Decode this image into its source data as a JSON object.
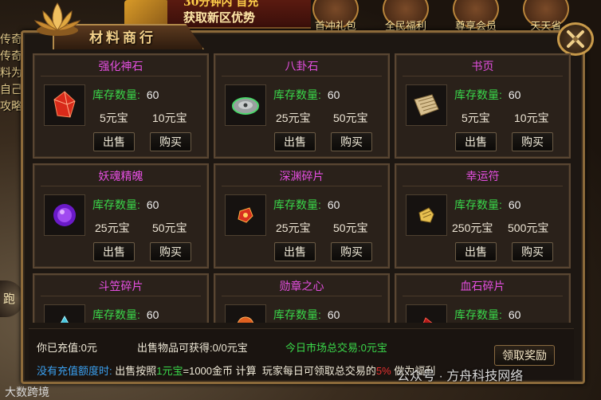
{
  "header": {
    "title": "材料商行",
    "promo_line1": "30分钟内 首充",
    "promo_line2": "获取新区优势",
    "top_icons": [
      "首冲礼包",
      "全民福利",
      "尊享会员",
      "天天省"
    ]
  },
  "side_text": [
    "传奇",
    "传奇",
    "料为",
    "自己",
    "攻略"
  ],
  "side_round_label": "跑",
  "unit": "元宝",
  "stock_label": "库存数量:",
  "sell_label": "出售",
  "buy_label": "购买",
  "items": [
    {
      "name": "强化神石",
      "stock": "60",
      "sell_price": "5元宝",
      "buy_price": "10元宝",
      "icon": "red-crystal-icon"
    },
    {
      "name": "八卦石",
      "stock": "60",
      "sell_price": "25元宝",
      "buy_price": "50元宝",
      "icon": "bagua-stone-icon"
    },
    {
      "name": "书页",
      "stock": "60",
      "sell_price": "5元宝",
      "buy_price": "10元宝",
      "icon": "scroll-page-icon"
    },
    {
      "name": "妖魂精魄",
      "stock": "60",
      "sell_price": "25元宝",
      "buy_price": "50元宝",
      "icon": "purple-soul-icon"
    },
    {
      "name": "深渊碎片",
      "stock": "60",
      "sell_price": "25元宝",
      "buy_price": "50元宝",
      "icon": "abyss-shard-icon"
    },
    {
      "name": "幸运符",
      "stock": "60",
      "sell_price": "250元宝",
      "buy_price": "500元宝",
      "icon": "lucky-charm-icon"
    },
    {
      "name": "斗笠碎片",
      "stock": "60",
      "sell_price": "",
      "buy_price": "",
      "icon": "hat-shard-icon"
    },
    {
      "name": "勋章之心",
      "stock": "60",
      "sell_price": "",
      "buy_price": "",
      "icon": "medal-heart-icon"
    },
    {
      "name": "血石碎片",
      "stock": "60",
      "sell_price": "",
      "buy_price": "",
      "icon": "blood-stone-icon"
    }
  ],
  "info": {
    "recharged_label": "你已充值:",
    "recharged_value": "0元",
    "sell_gain_label": "出售物品可获得:",
    "sell_gain_value": "0/0元宝",
    "market_label": "今日市场总交易:",
    "market_value": "0元宝",
    "no_quota": "没有充值额度时:",
    "rule_a": "出售按照",
    "rule_rate": "1元宝",
    "rule_eq": "=1000金币",
    "rule_b": "计算",
    "rule_c": "玩家每日可领取总交易的",
    "rule_pct": "5%",
    "rule_d": "做为福利",
    "claim_button": "领取奖励"
  },
  "watermark": "公众号 · 方舟科技网络",
  "watermark_left": "大数跨境",
  "colors": {
    "item_name": "#e44fe0",
    "stock_label": "#3ad84a",
    "highlight_blue": "#3aa0f0",
    "highlight_red": "#e83030",
    "gold": "#c89a4a"
  }
}
